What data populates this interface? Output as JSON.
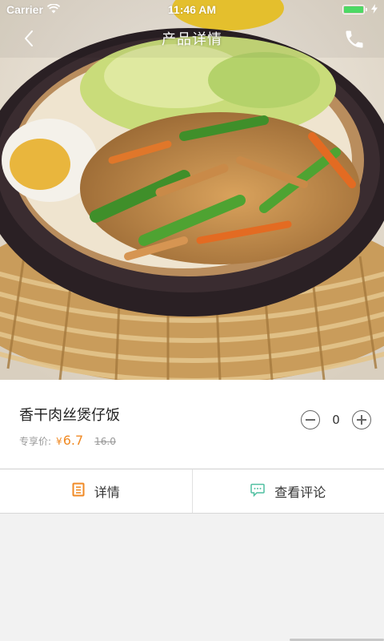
{
  "status_bar": {
    "carrier": "Carrier",
    "time": "11:46 AM",
    "battery_level": 1.0,
    "battery_color": "#4cd964"
  },
  "nav": {
    "title": "产品详情",
    "back_icon": "chevron-left-icon",
    "phone_icon": "phone-icon"
  },
  "product": {
    "name": "香干肉丝煲仔饭",
    "price_label": "专享价:",
    "currency": "¥",
    "price": "6.7",
    "original_price": "16.0",
    "quantity": "0"
  },
  "tabs": [
    {
      "label": "详情",
      "icon": "document-icon",
      "icon_color": "#f08a24"
    },
    {
      "label": "查看评论",
      "icon": "comment-icon",
      "icon_color": "#4fbfa0"
    }
  ],
  "colors": {
    "accent": "#f08a24",
    "muted_text": "#999999"
  }
}
